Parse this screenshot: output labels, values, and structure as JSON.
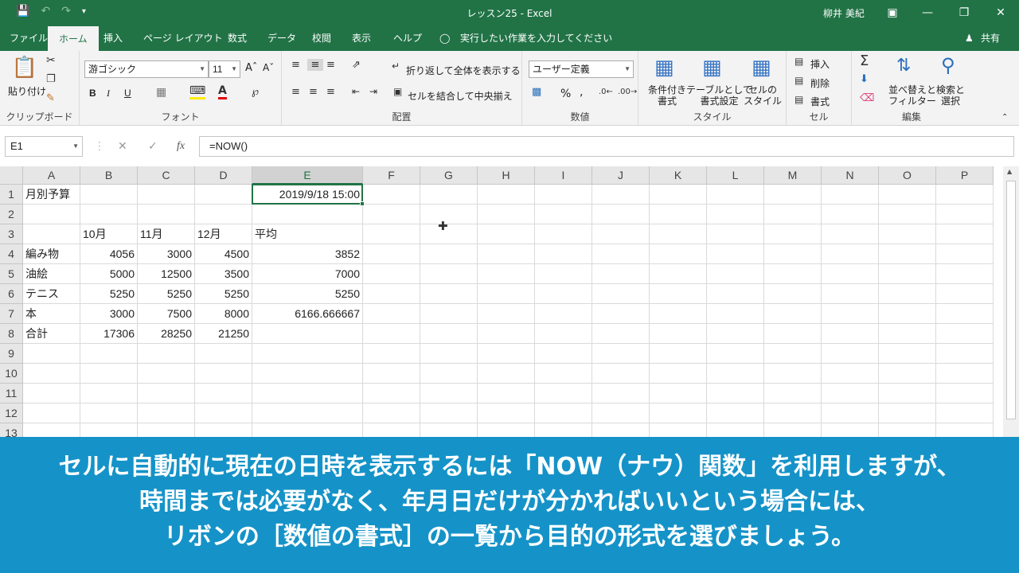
{
  "titlebar": {
    "title": "レッスン25  -  Excel",
    "user": "柳井 美紀",
    "save_icon": "save-icon",
    "undo_icon": "undo-icon",
    "redo_icon": "redo-icon",
    "customize_icon": "qat-dropdown-icon"
  },
  "tabs": [
    "ファイル",
    "ホーム",
    "挿入",
    "ページ レイアウト",
    "数式",
    "データ",
    "校閲",
    "表示",
    "ヘルプ"
  ],
  "tell_me": "実行したい作業を入力してください",
  "share": "共有",
  "ribbon": {
    "clipboard": {
      "paste": "貼り付け",
      "label": "クリップボード"
    },
    "font": {
      "name": "游ゴシック",
      "size": "11",
      "bold": "B",
      "italic": "I",
      "underline": "U",
      "label": "フォント"
    },
    "alignment": {
      "wrap": "折り返して全体を表示する",
      "merge": "セルを結合して中央揃え",
      "label": "配置"
    },
    "number": {
      "format": "ユーザー定義",
      "percent": "%",
      "comma": ",",
      "label": "数値"
    },
    "styles": {
      "conditional": "条件付き",
      "conditional2": "書式",
      "table": "テーブルとして",
      "table2": "書式設定",
      "cell": "セルの",
      "cell2": "スタイル",
      "label": "スタイル"
    },
    "cells": {
      "insert": "挿入",
      "delete": "削除",
      "format": "書式",
      "label": "セル"
    },
    "editing": {
      "sort": "並べ替えと",
      "sort2": "フィルター",
      "find": "検索と",
      "find2": "選択",
      "label": "編集"
    }
  },
  "formula_bar": {
    "name_box": "E1",
    "formula": "=NOW()",
    "fx": "fx"
  },
  "columns": [
    "A",
    "B",
    "C",
    "D",
    "E",
    "F",
    "G",
    "H",
    "I",
    "J",
    "K",
    "L",
    "M",
    "N",
    "O",
    "P"
  ],
  "rows": [
    "1",
    "2",
    "3",
    "4",
    "5",
    "6",
    "7",
    "8",
    "9",
    "10",
    "11",
    "12",
    "13"
  ],
  "cells": {
    "A1": "月別予算",
    "E1": "2019/9/18 15:00",
    "B3": "10月",
    "C3": "11月",
    "D3": "12月",
    "E3": "平均",
    "A4": "編み物",
    "B4": "4056",
    "C4": "3000",
    "D4": "4500",
    "E4": "3852",
    "A5": "油絵",
    "B5": "5000",
    "C5": "12500",
    "D5": "3500",
    "E5": "7000",
    "A6": "テニス",
    "B6": "5250",
    "C6": "5250",
    "D6": "5250",
    "E6": "5250",
    "A7": "本",
    "B7": "3000",
    "C7": "7500",
    "D7": "8000",
    "E7": "6166.666667",
    "A8": "合計",
    "B8": "17306",
    "C8": "28250",
    "D8": "21250"
  },
  "caption": [
    "セルに自動的に現在の日時を表示するには「NOW（ナウ）関数」を利用しますが、",
    "時間までは必要がなく、年月日だけが分かればいいという場合には、",
    "リボンの［数値の書式］の一覧から目的の形式を選びましょう。"
  ]
}
